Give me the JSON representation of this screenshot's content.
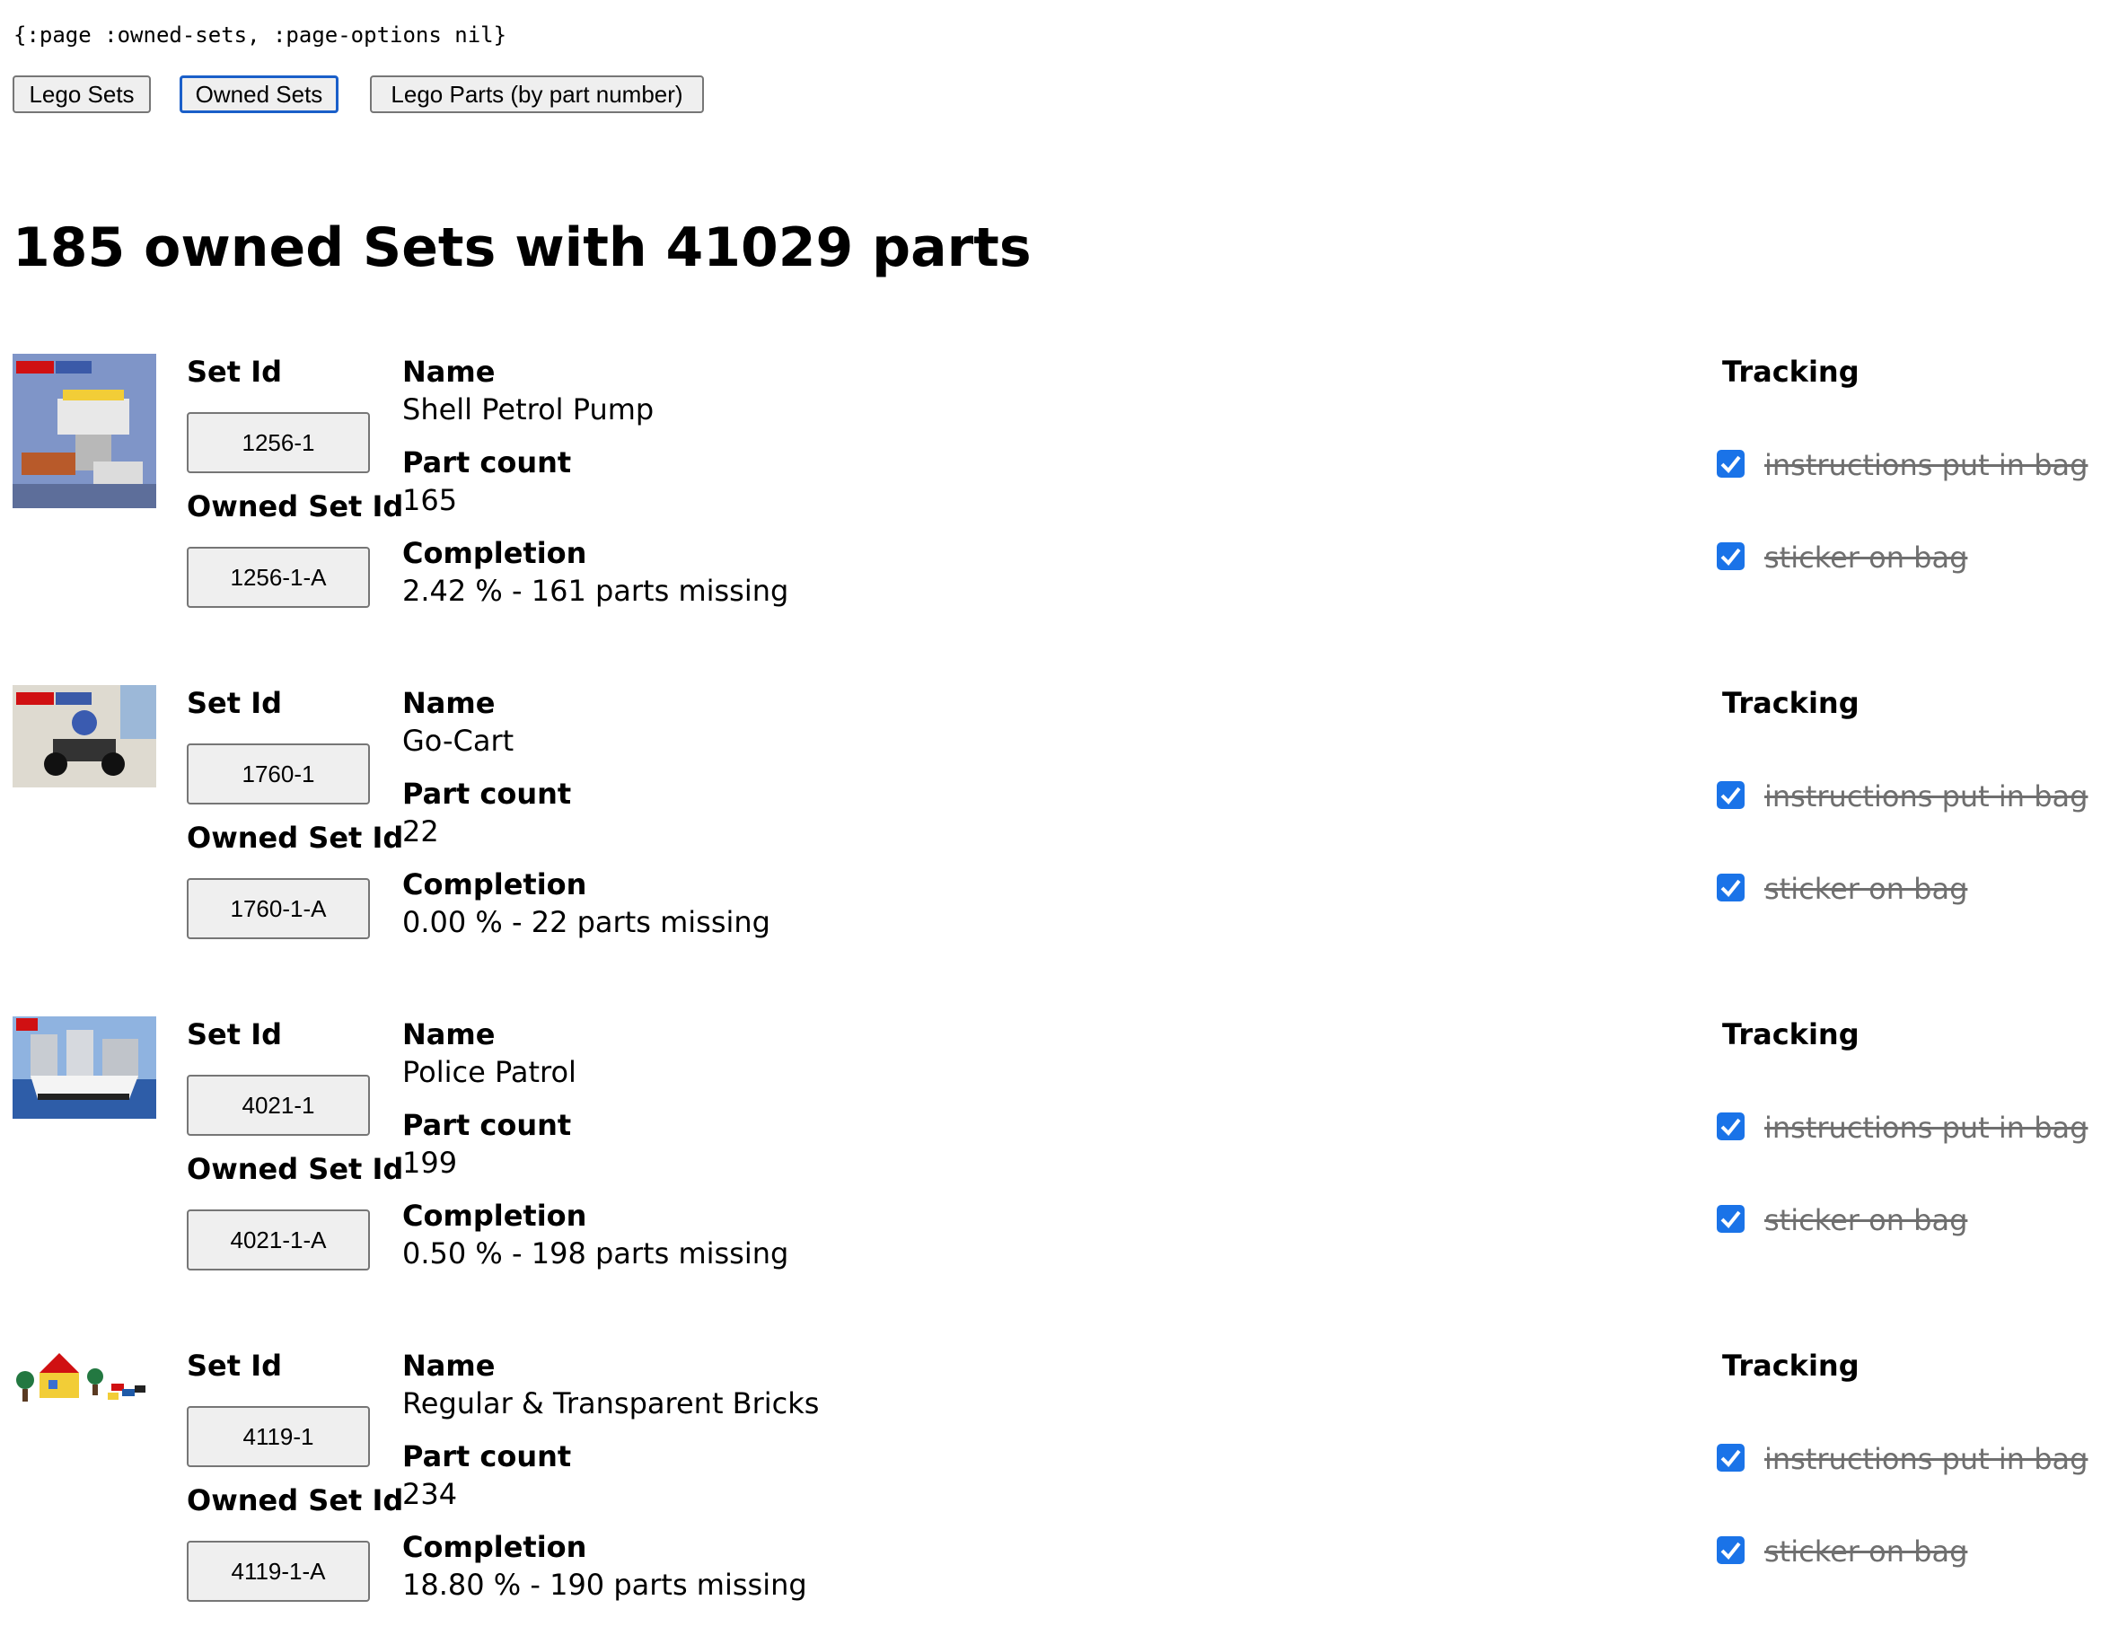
{
  "debug_text": "{:page :owned-sets, :page-options nil}",
  "nav": {
    "lego_sets": "Lego Sets",
    "owned_sets": "Owned Sets",
    "lego_parts": "Lego Parts (by part number)"
  },
  "heading": "185 owned Sets with 41029 parts",
  "labels": {
    "set_id": "Set Id",
    "owned_set_id": "Owned Set Id",
    "name": "Name",
    "part_count": "Part count",
    "completion": "Completion",
    "tracking": "Tracking"
  },
  "sets": [
    {
      "set_id": "1256-1",
      "owned_set_id": "1256-1-A",
      "name": "Shell Petrol Pump",
      "part_count": "165",
      "completion": "2.42 % - 161 parts missing",
      "tracking": [
        {
          "label": "instructions put in bag",
          "checked": true
        },
        {
          "label": "sticker on bag",
          "checked": true
        }
      ]
    },
    {
      "set_id": "1760-1",
      "owned_set_id": "1760-1-A",
      "name": "Go-Cart",
      "part_count": "22",
      "completion": "0.00 % - 22 parts missing",
      "tracking": [
        {
          "label": "instructions put in bag",
          "checked": true
        },
        {
          "label": "sticker on bag",
          "checked": true
        }
      ]
    },
    {
      "set_id": "4021-1",
      "owned_set_id": "4021-1-A",
      "name": "Police Patrol",
      "part_count": "199",
      "completion": "0.50 % - 198 parts missing",
      "tracking": [
        {
          "label": "instructions put in bag",
          "checked": true
        },
        {
          "label": "sticker on bag",
          "checked": true
        }
      ]
    },
    {
      "set_id": "4119-1",
      "owned_set_id": "4119-1-A",
      "name": "Regular & Transparent Bricks",
      "part_count": "234",
      "completion": "18.80 % - 190 parts missing",
      "tracking": [
        {
          "label": "instructions put in bag",
          "checked": true
        },
        {
          "label": "sticker on bag",
          "checked": true
        }
      ]
    }
  ]
}
